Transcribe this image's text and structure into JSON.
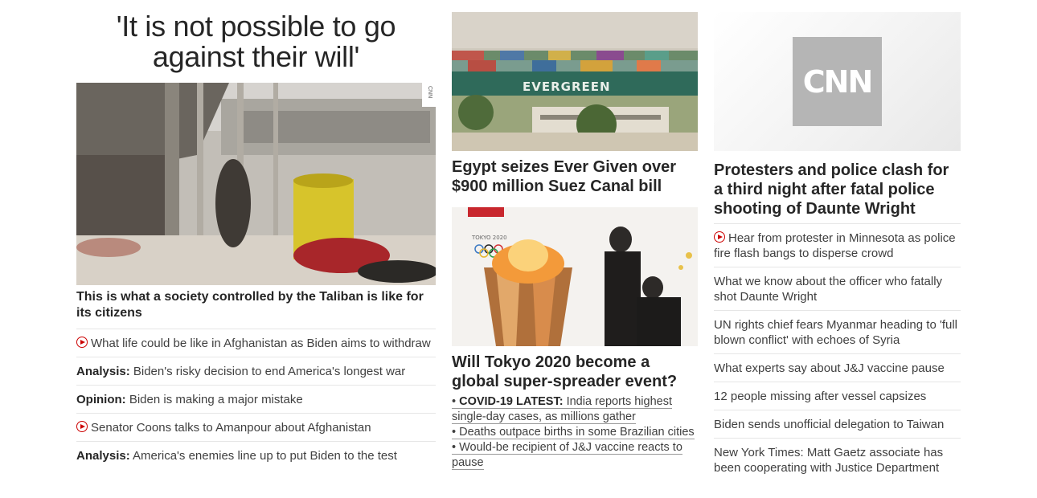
{
  "col1": {
    "hero_title_line1": "'It is not possible to go",
    "hero_title_line2": "against their will'",
    "image_watermark": "CNN",
    "headline": "This is what a society controlled by the Taliban is like for its citizens",
    "links": [
      {
        "video": true,
        "prefix": "",
        "text": "What life could be like in Afghanistan as Biden aims to withdraw"
      },
      {
        "video": false,
        "prefix": "Analysis:",
        "text": "Biden's risky decision to end America's longest war"
      },
      {
        "video": false,
        "prefix": "Opinion:",
        "text": "Biden is making a major mistake"
      },
      {
        "video": true,
        "prefix": "",
        "text": "Senator Coons talks to Amanpour about Afghanistan"
      },
      {
        "video": false,
        "prefix": "Analysis:",
        "text": "America's enemies line up to put Biden to the test"
      }
    ]
  },
  "col2": {
    "ship_text": "EVERGREEN",
    "headline1": "Egypt seizes Ever Given over $900 million Suez Canal bill",
    "olympics_text": "TOKYO 2020",
    "headline2": "Will Tokyo 2020 become a global super-spreader event?",
    "bullets": [
      {
        "prefix": "COVID-19 LATEST:",
        "text": "India reports highest single-day cases, as millions gather"
      },
      {
        "prefix": "",
        "text": "Deaths outpace births in some Brazilian cities"
      },
      {
        "prefix": "",
        "text": "Would-be recipient of J&J vaccine reacts to pause"
      }
    ],
    "bullet_char": "•"
  },
  "col3": {
    "logo_text": "CNN",
    "headline": "Protesters and police clash for a third night after fatal police shooting of Daunte Wright",
    "links": [
      {
        "video": true,
        "text": "Hear from protester in Minnesota as police fire flash bangs to disperse crowd"
      },
      {
        "video": false,
        "text": "What we know about the officer who fatally shot Daunte Wright"
      },
      {
        "video": false,
        "text": "UN rights chief fears Myanmar heading to 'full blown conflict' with echoes of Syria"
      },
      {
        "video": false,
        "text": "What experts say about J&J vaccine pause"
      },
      {
        "video": false,
        "text": "12 people missing after vessel capsizes"
      },
      {
        "video": false,
        "text": "Biden sends unofficial delegation to Taiwan"
      },
      {
        "video": false,
        "text": "New York Times: Matt Gaetz associate has been cooperating with Justice Department"
      }
    ]
  },
  "colors": {
    "headline": "#262626",
    "body": "#404040",
    "divider": "#e6e6e6",
    "video_red": "#cc0000",
    "logo_bg": "#b5b5b5"
  },
  "icons": {
    "video": "play-circle-icon"
  }
}
